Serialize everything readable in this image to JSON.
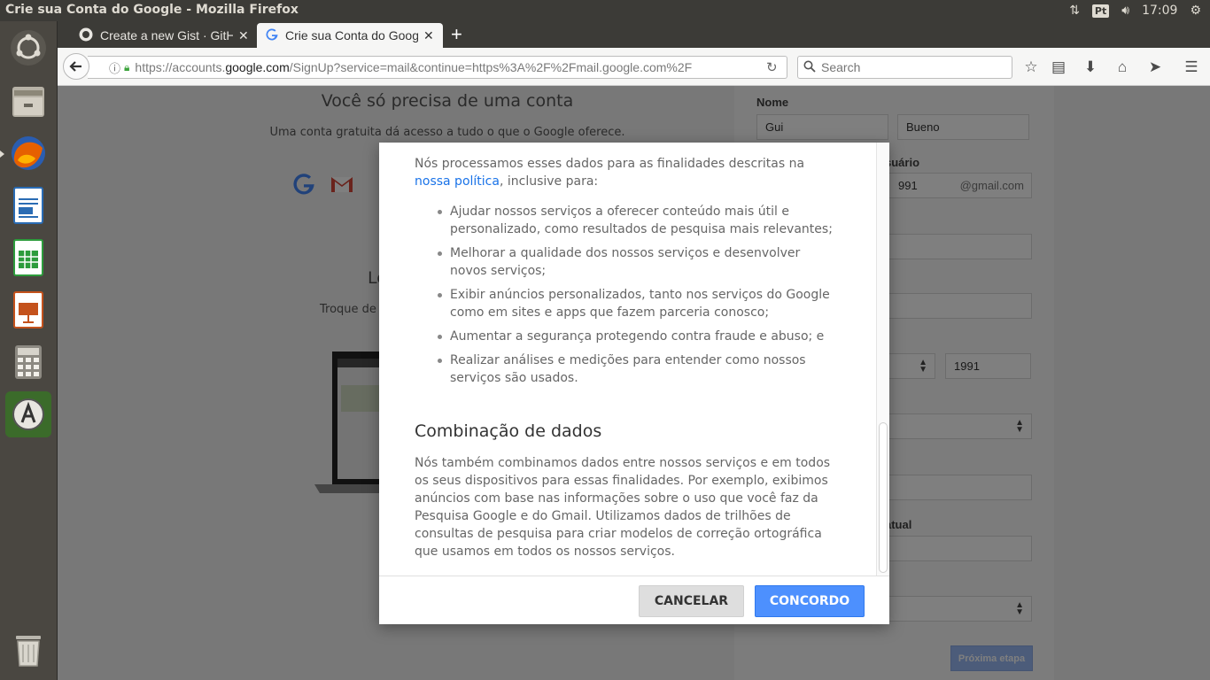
{
  "window": {
    "title": "Crie sua Conta do Google - Mozilla Firefox"
  },
  "system_tray": {
    "keyboard_layout": "Pt",
    "clock": "17:09"
  },
  "browser": {
    "tabs": [
      {
        "label": "Create a new Gist · GitHub",
        "active": false,
        "icon": "github-icon"
      },
      {
        "label": "Crie sua Conta do Google",
        "active": true,
        "icon": "google-g-icon"
      }
    ],
    "url_prefix": "https://accounts.",
    "url_domain": "google.com",
    "url_rest": "/SignUp?service=mail&continue=https%3A%2F%2Fmail.google.com%2F",
    "search_placeholder": "Search"
  },
  "background_page": {
    "heading": "Você só precisa de uma conta",
    "subheading": "Uma conta gratuita dá acesso a tudo o que o Google oferece.",
    "partial_heading": "Le",
    "partial_text": "Troque de c",
    "form": {
      "name_label": "Nome",
      "first_name": "Gui",
      "last_name": "Bueno",
      "username_label_fragment": "suário",
      "username_value_fragment": "991",
      "gmail_suffix": "@gmail.com",
      "birth_year": "1991",
      "email_label_fragment": "atual",
      "next_button": "Próxima etapa"
    }
  },
  "modal": {
    "intro_text": "Nós processamos esses dados para as finalidades descritas na ",
    "intro_link": "nossa política",
    "intro_text_end": ", inclusive para:",
    "bullets": [
      "Ajudar nossos serviços a oferecer conteúdo mais útil e personalizado, como resultados de pesquisa mais relevantes;",
      "Melhorar a qualidade dos nossos serviços e desenvolver novos serviços;",
      "Exibir anúncios personalizados, tanto nos serviços do Google como em sites e apps que fazem parceria conosco;",
      "Aumentar a segurança protegendo contra fraude e abuso; e",
      "Realizar análises e medições para entender como nossos serviços são usados."
    ],
    "section_heading": "Combinação de dados",
    "section_text": "Nós também combinamos dados entre nossos serviços e em todos os seus dispositivos para essas finalidades. Por exemplo, exibimos anúncios com base nas informações sobre o uso que você faz da Pesquisa Google e do Gmail. Utilizamos dados de trilhões de consultas de pesquisa para criar modelos de correção ortográfica que usamos em todos os nossos serviços.",
    "cancel_label": "CANCELAR",
    "agree_label": "CONCORDO"
  },
  "launcher": {
    "items": [
      "ubuntu-dash-icon",
      "files-icon",
      "firefox-icon",
      "writer-icon",
      "calc-icon",
      "impress-icon",
      "calculator-icon",
      "software-updater-icon",
      "trash-icon"
    ]
  },
  "colors": {
    "panel": "#3c3b37",
    "accent_blue": "#4d90fe",
    "link_blue": "#1a73e8"
  }
}
